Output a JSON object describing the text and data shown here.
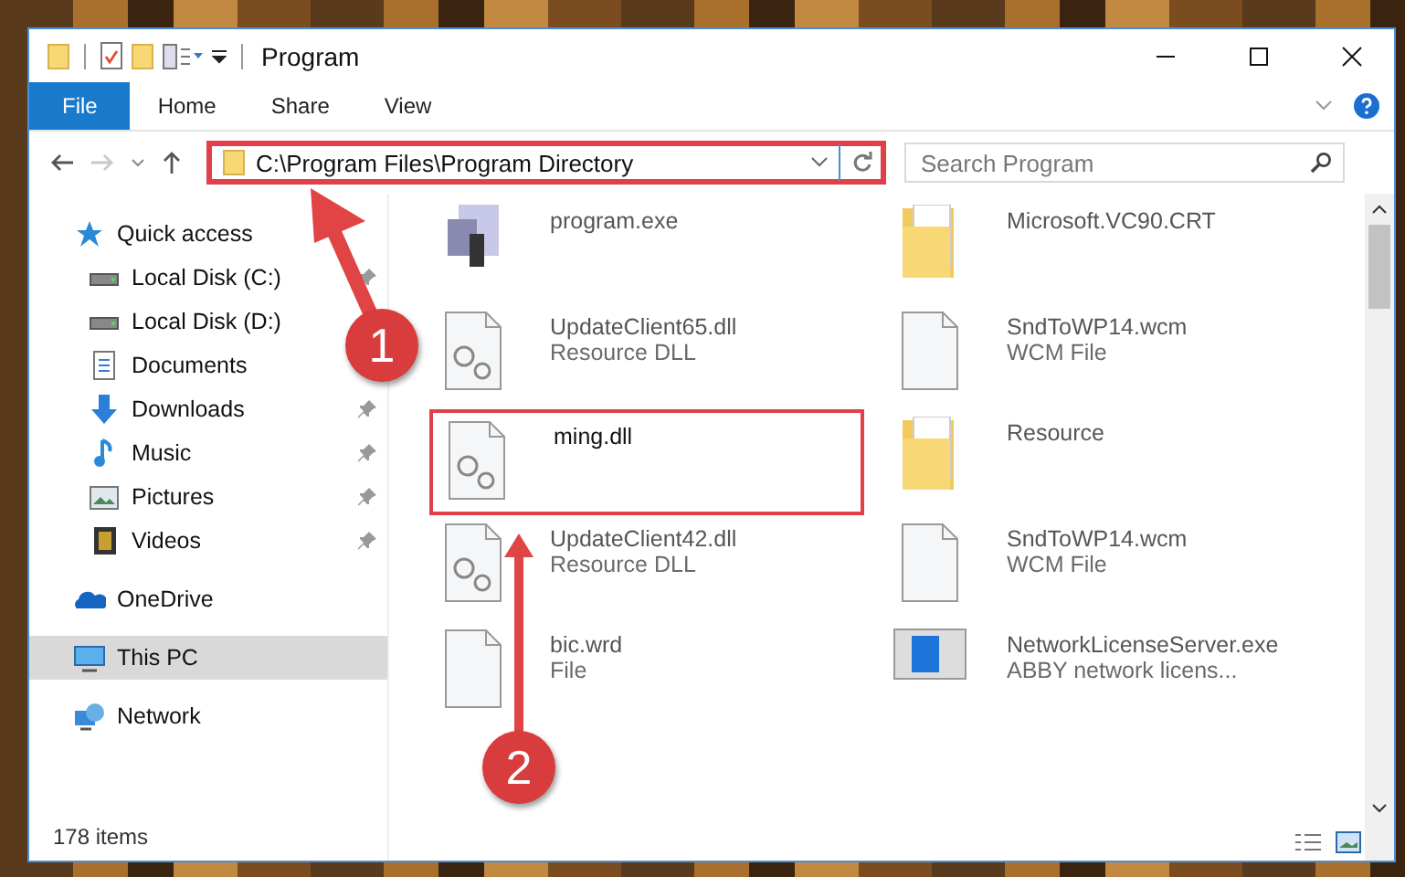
{
  "window": {
    "title": "Program"
  },
  "ribbon_tabs": [
    {
      "label": "File",
      "selected": true
    },
    {
      "label": "Home",
      "selected": false
    },
    {
      "label": "Share",
      "selected": false
    },
    {
      "label": "View",
      "selected": false
    }
  ],
  "address_bar": {
    "value": "C:\\Program Files\\Program Directory",
    "highlighted": true
  },
  "search": {
    "placeholder": "Search Program"
  },
  "sidebar": {
    "items": [
      {
        "label": "Quick access",
        "kind": "quick",
        "selected": false,
        "children": [
          {
            "label": "Local Disk (C:)",
            "kind": "disk",
            "pinned": true,
            "selected": false
          },
          {
            "label": "Local Disk (D:)",
            "kind": "disk",
            "pinned": false,
            "selected": false
          },
          {
            "label": "Documents",
            "kind": "documents",
            "pinned": false,
            "selected": false
          },
          {
            "label": "Downloads",
            "kind": "downloads",
            "pinned": true,
            "selected": false
          },
          {
            "label": "Music",
            "kind": "music",
            "pinned": true,
            "selected": false
          },
          {
            "label": "Pictures",
            "kind": "pictures",
            "pinned": true,
            "selected": false
          },
          {
            "label": "Videos",
            "kind": "videos",
            "pinned": true,
            "selected": false
          }
        ]
      },
      {
        "label": "OneDrive",
        "kind": "onedrive",
        "selected": false
      },
      {
        "label": "This PC",
        "kind": "pc",
        "selected": true
      },
      {
        "label": "Network",
        "kind": "network",
        "selected": false
      }
    ]
  },
  "files": [
    {
      "name": "program.exe",
      "kind": "exe",
      "dimmed": true,
      "highlighted": false
    },
    {
      "name": "Microsoft.VC90.CRT",
      "kind": "folder",
      "dimmed": true,
      "highlighted": false
    },
    {
      "name": "UpdateClient65.dll",
      "type": "Resource DLL",
      "kind": "dll",
      "dimmed": true,
      "highlighted": false
    },
    {
      "name": "SndToWP14.wcm",
      "type": "WCM File",
      "kind": "file",
      "dimmed": true,
      "highlighted": false
    },
    {
      "name": "ming.dll",
      "kind": "dll",
      "dimmed": false,
      "highlighted": true
    },
    {
      "name": "Resource",
      "kind": "folder",
      "dimmed": true,
      "highlighted": false
    },
    {
      "name": "UpdateClient42.dll",
      "type": "Resource DLL",
      "kind": "dll",
      "dimmed": true,
      "highlighted": false
    },
    {
      "name": "SndToWP14.wcm",
      "type": "WCM File",
      "kind": "file",
      "dimmed": true,
      "highlighted": false
    },
    {
      "name": "bic.wrd",
      "type": "File",
      "kind": "file",
      "dimmed": true,
      "highlighted": false
    },
    {
      "name": "NetworkLicenseServer.exe",
      "type": "ABBY network licens...",
      "kind": "app",
      "dimmed": true,
      "highlighted": false
    }
  ],
  "status_bar": {
    "count": "178 items"
  },
  "annotations": [
    {
      "number": "1"
    },
    {
      "number": "2"
    }
  ]
}
